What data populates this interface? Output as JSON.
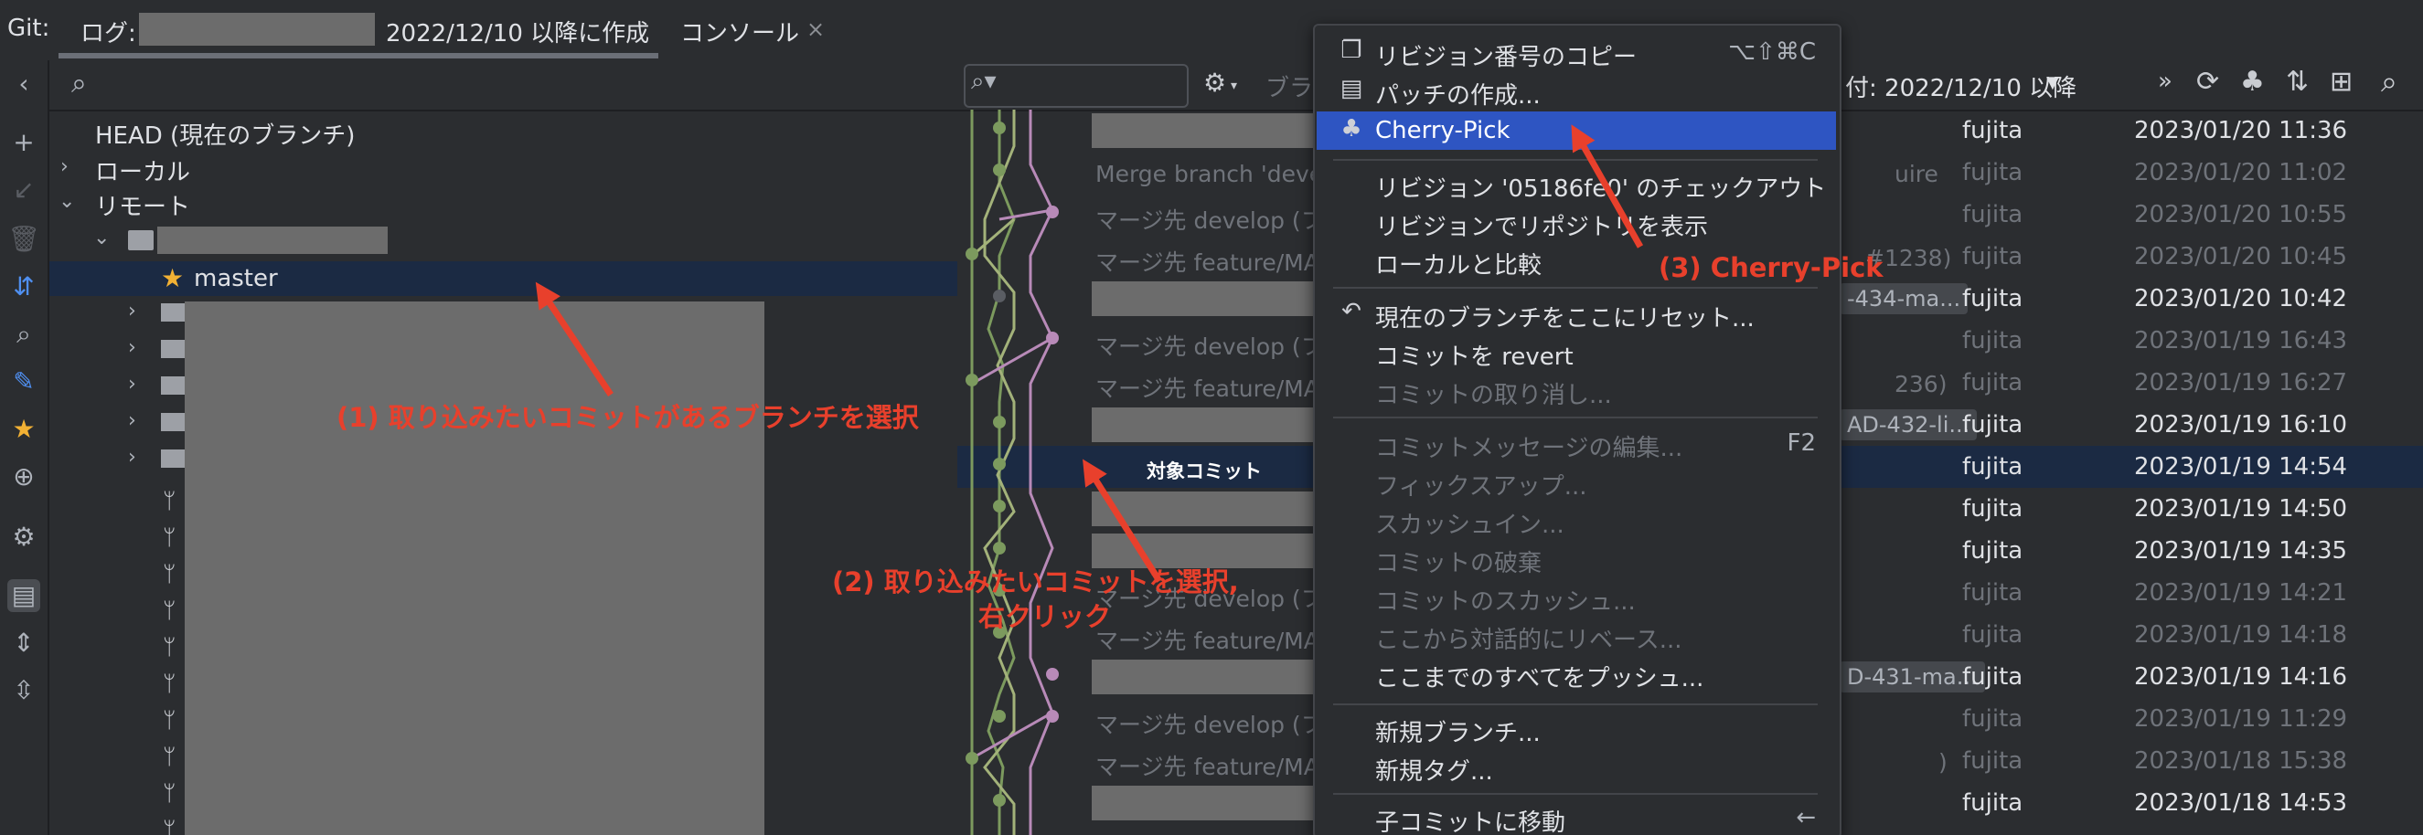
{
  "tabbar": {
    "git_label": "Git:",
    "log_tab_prefix": "ログ:",
    "log_tab_suffix": "2022/12/10 以降に作成",
    "console_tab": "コンソール",
    "close_glyph": "×"
  },
  "branch_tree": {
    "search_placeholder": "",
    "head": "HEAD (現在のブランチ)",
    "local": "ローカル",
    "remote": "リモート",
    "master": "master"
  },
  "log_toolbar": {
    "branch_filter_partial": "ブラ",
    "date_filter": "付: 2022/12/10 以降",
    "more": "»"
  },
  "commits": [
    {
      "message": "",
      "author": "fujita",
      "date": "2023/01/20 11:36",
      "dim": false,
      "redacted": true
    },
    {
      "message": "Merge branch 'deve",
      "tail": "uire",
      "author": "fujita",
      "date": "2023/01/20 11:02",
      "dim": true
    },
    {
      "message": "マージ先 develop (フ",
      "author": "fujita",
      "date": "2023/01/20 10:55",
      "dim": true
    },
    {
      "message": "マージ先 feature/MA",
      "tail": "#1238)",
      "author": "fujita",
      "date": "2023/01/20 10:45",
      "dim": true
    },
    {
      "message": "",
      "tag": "-434-ma...",
      "author": "fujita",
      "date": "2023/01/20 10:42",
      "dim": false,
      "redacted": true
    },
    {
      "message": "マージ先 develop (フ",
      "author": "fujita",
      "date": "2023/01/19 16:43",
      "dim": true
    },
    {
      "message": "マージ先 feature/MA",
      "tail": "236)",
      "author": "fujita",
      "date": "2023/01/19 16:27",
      "dim": true
    },
    {
      "message": "",
      "tag": "AD-432-li...",
      "author": "fujita",
      "date": "2023/01/19 16:10",
      "dim": false,
      "redacted": true
    },
    {
      "message": "対象コミット",
      "author": "fujita",
      "date": "2023/01/19 14:54",
      "dim": false,
      "selected": true
    },
    {
      "message": "",
      "author": "fujita",
      "date": "2023/01/19 14:50",
      "dim": false,
      "redacted": true
    },
    {
      "message": "",
      "author": "fujita",
      "date": "2023/01/19 14:35",
      "dim": false,
      "redacted": true
    },
    {
      "message": "マージ先 develop (フ",
      "author": "fujita",
      "date": "2023/01/19 14:21",
      "dim": true
    },
    {
      "message": "マージ先 feature/MA",
      "author": "fujita",
      "date": "2023/01/19 14:18",
      "dim": true
    },
    {
      "message": "",
      "tag": "D-431-ma...",
      "author": "fujita",
      "date": "2023/01/19 14:16",
      "dim": false,
      "redacted": true
    },
    {
      "message": "マージ先 develop (フ",
      "author": "fujita",
      "date": "2023/01/19 11:29",
      "dim": true
    },
    {
      "message": "マージ先 feature/MA",
      "tail": ")",
      "author": "fujita",
      "date": "2023/01/18 15:38",
      "dim": true
    },
    {
      "message": "",
      "author": "fujita",
      "date": "2023/01/18 14:53",
      "dim": false,
      "redacted": true
    }
  ],
  "context_menu": {
    "copy_revision": "リビジョン番号のコピー",
    "copy_revision_shortcut": "⌥⇧⌘C",
    "create_patch": "パッチの作成...",
    "cherry_pick": "Cherry-Pick",
    "checkout_revision": "リビジョン '05186fe0' のチェックアウト",
    "show_repo_at_revision": "リビジョンでリポジトリを表示",
    "compare_with_local": "ローカルと比較",
    "reset_branch": "現在のブランチをここにリセット...",
    "revert_commit": "コミットを revert",
    "undo_commit": "コミットの取り消し...",
    "edit_message": "コミットメッセージの編集...",
    "edit_message_shortcut": "F2",
    "fixup": "フィックスアップ...",
    "squash_into": "スカッシュイン...",
    "drop_commits": "コミットの破棄",
    "squash_commits": "コミットのスカッシュ...",
    "interactive_rebase": "ここから対話的にリベース...",
    "push_all_up_to_here": "ここまでのすべてをプッシュ...",
    "new_branch": "新規ブランチ...",
    "new_tag": "新規タグ...",
    "go_to_child": "子コミットに移動",
    "go_to_child_shortcut": "←"
  },
  "annotations": {
    "step1": "(1) 取り込みたいコミットがあるブランチを選択",
    "step2_line1": "(2) 取り込みたいコミットを選択,",
    "step2_line2": "右クリック",
    "step3": "(3) Cherry-Pick"
  },
  "colors": {
    "background": "#2b2d30",
    "selection": "#1b2a43",
    "menu_highlight": "#2e55c2",
    "annotation": "#e8402c",
    "graph_green": "#7c9a5e",
    "graph_pink": "#b88ab8"
  }
}
